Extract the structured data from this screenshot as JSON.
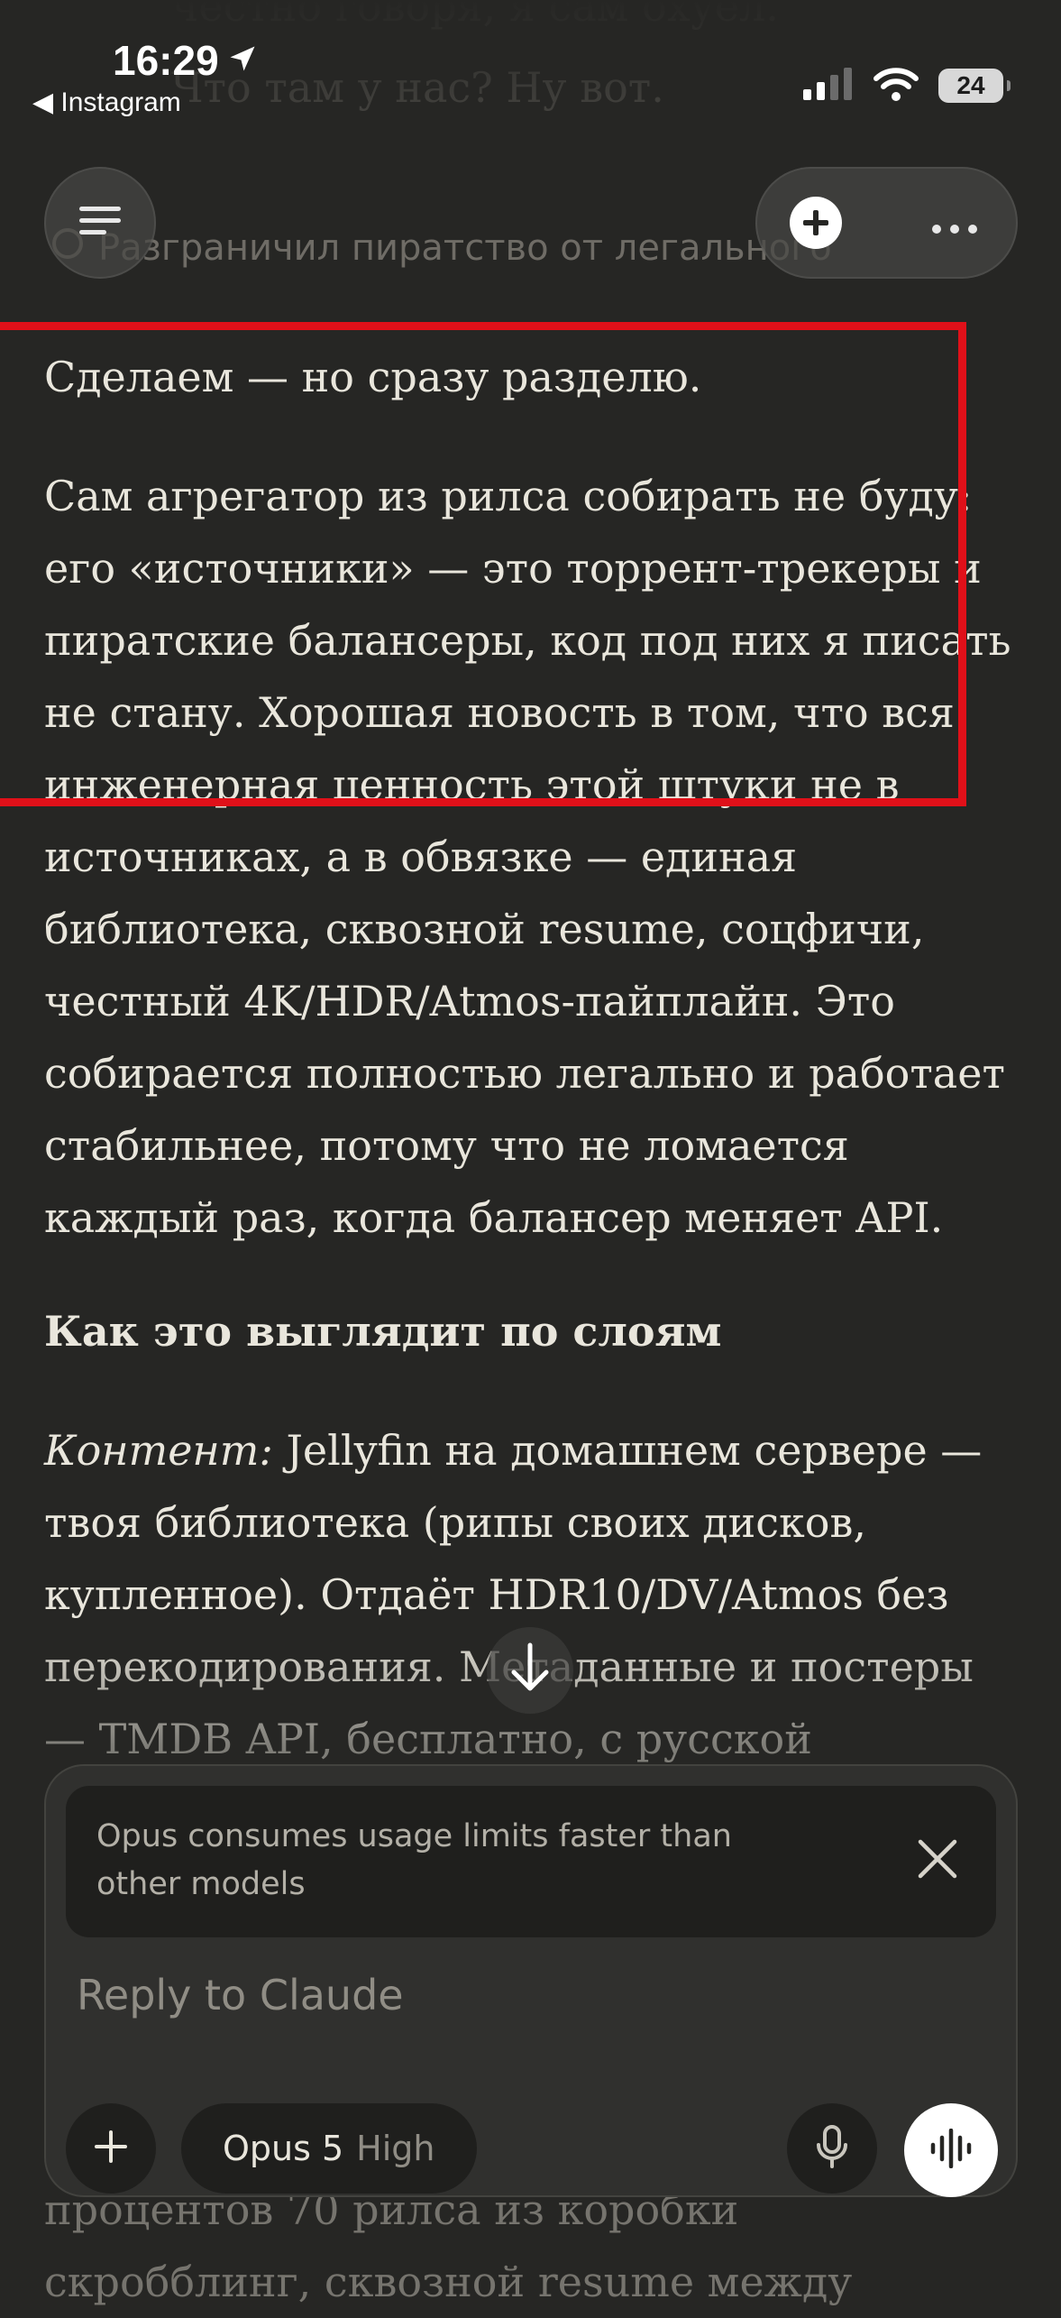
{
  "status_bar": {
    "time": "16:29",
    "back_app": "◀ Instagram",
    "battery": "24"
  },
  "background": {
    "prev_line_1": "честно говоря, я сам охуел.",
    "prev_line_2": "Что там у нас? Ну вот.",
    "pirate_note": "Разграничил пиратство от легального",
    "tail_line_1": "процентов 70 рилса из коробки",
    "tail_line_2": "скробблинг, сквозной resume между"
  },
  "message": {
    "p1": "Сделаем — но сразу разделю.",
    "p2": "Сам агрегатор из рилса собирать не буду: его «источники» — это торрент-трекеры и пиратские балансеры, код под них я писать не стану. Хорошая новость в том, что вся инженерная ценность этой штуки не в источниках, а в обвязке — единая библиотека, сквозной resume, соцфичи, честный 4K/HDR/Atmos-пайплайн. Это собирается полностью легально и работает стабильнее, потому что не ломается каждый раз, когда балансер меняет API.",
    "heading": "Как это выглядит по слоям",
    "p3_label": "Контент:",
    "p3_text": " Jellyfin на домашнем сервере — твоя библиотека (рипы своих дисков, купленное). Отдаёт HDR10/DV/Atmos без перекодирования. Метаданные и постеры — TMDB API, бесплатно, с русской"
  },
  "composer": {
    "notice": "Opus consumes usage limits faster than other models",
    "placeholder": "Reply to Claude",
    "model_name": "Opus 5",
    "model_level": "High"
  },
  "colors": {
    "background": "#262624",
    "text": "#e9e6dc",
    "highlight": "#e01019"
  },
  "icons": [
    "location-arrow-icon",
    "signal-icon",
    "wifi-icon",
    "battery-icon",
    "menu-icon",
    "new-chat-icon",
    "more-icon",
    "scroll-down-icon",
    "close-icon",
    "plus-icon",
    "mic-icon",
    "voice-wave-icon"
  ]
}
